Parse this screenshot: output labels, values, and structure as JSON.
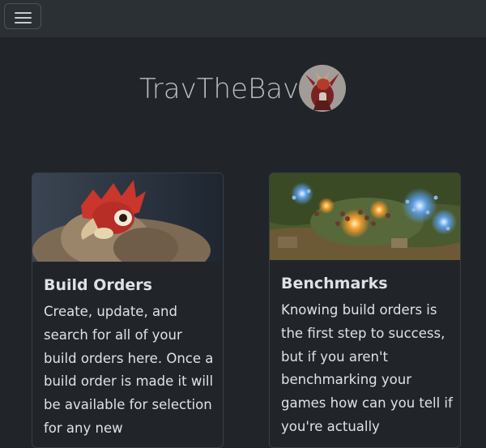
{
  "navbar": {
    "toggle_icon": "hamburger-menu-icon"
  },
  "brand": {
    "title": "TravTheBav"
  },
  "cards": [
    {
      "title": "Build Orders",
      "text": "Create, update, and search for all of your build orders here. Once a build order is made it will be available for selection for any new"
    },
    {
      "title": "Benchmarks",
      "text": "Knowing build orders is the first step to success, but if you aren't benchmarking your games how can you tell if you're actually"
    }
  ]
}
